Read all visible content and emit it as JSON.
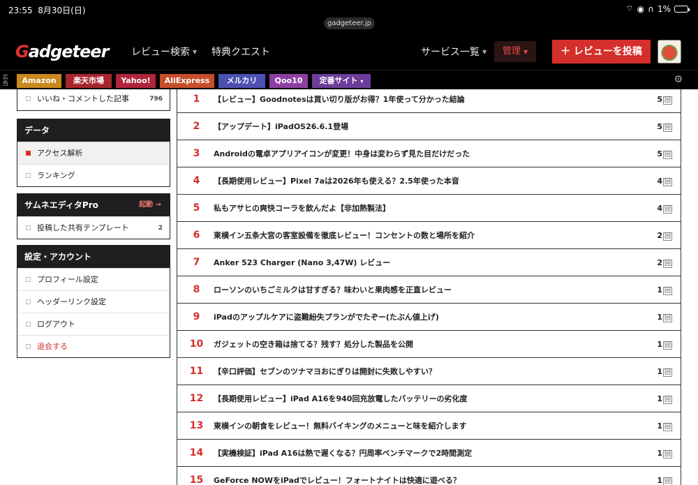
{
  "status_bar": {
    "time": "23:55",
    "date": "8月30日(日)",
    "battery": "1%"
  },
  "url": "gadgeteer.jp",
  "header": {
    "logo": "Gadgeteer",
    "nav": [
      {
        "label": "レビュー検索",
        "dropdown": true
      },
      {
        "label": "特典クエスト",
        "dropdown": false
      }
    ],
    "service": "サービス一覧",
    "admin": "管理",
    "post_button": "＋ レビューを投稿"
  },
  "ad_bar": {
    "label": "広告",
    "tags": [
      {
        "label": "Amazon",
        "color": "#c9891d"
      },
      {
        "label": "楽天市場",
        "color": "#a8262e"
      },
      {
        "label": "Yahoo!",
        "color": "#b0243c"
      },
      {
        "label": "AliExpress",
        "color": "#c64e2c"
      },
      {
        "label": "メルカリ",
        "color": "#4c50b2"
      },
      {
        "label": "Qoo10",
        "color": "#8d3fa3"
      },
      {
        "label": "定番サイト",
        "color": "#6c3d9a"
      }
    ]
  },
  "sidebar": {
    "top_item": {
      "label": "いいね・コメントした記事",
      "count": "796"
    },
    "data": {
      "title": "データ",
      "items": [
        {
          "label": "アクセス解析",
          "active": true
        },
        {
          "label": "ランキング",
          "active": false
        }
      ]
    },
    "thumb": {
      "title": "サムネエディタPro",
      "launch": "起動 →",
      "items": [
        {
          "label": "投稿した共有テンプレート",
          "count": "2"
        }
      ]
    },
    "settings": {
      "title": "設定・アカウント",
      "items": [
        {
          "label": "プロフィール設定"
        },
        {
          "label": "ヘッダーリンク設定"
        },
        {
          "label": "ログアウト"
        },
        {
          "label": "退会する"
        }
      ]
    }
  },
  "ranking": {
    "unit": "回",
    "rows": [
      {
        "rank": "1",
        "title": "【レビュー】Goodnotesは買い切り版がお得？1年使って分かった結論",
        "count": "5"
      },
      {
        "rank": "2",
        "title": "【アップデート】iPadOS26.6.1登場",
        "count": "5"
      },
      {
        "rank": "3",
        "title": "Androidの電卓アプリアイコンが変更！中身は変わらず見た目だけだった",
        "count": "5"
      },
      {
        "rank": "4",
        "title": "【長期使用レビュー】Pixel 7aは2026年も使える？2.5年使った本音",
        "count": "4"
      },
      {
        "rank": "5",
        "title": "私もアサヒの爽快コーラを飲んだよ【非加熱製法】",
        "count": "4"
      },
      {
        "rank": "6",
        "title": "東横イン五条大宮の客室設備を徹底レビュー！コンセントの数と場所を紹介",
        "count": "2"
      },
      {
        "rank": "7",
        "title": "Anker 523 Charger (Nano 3,47W) レビュー",
        "count": "2"
      },
      {
        "rank": "8",
        "title": "ローソンのいちごミルクは甘すぎる？味わいと果肉感を正直レビュー",
        "count": "1"
      },
      {
        "rank": "9",
        "title": "iPadのアップルケアに盗難紛失プランがでたぞー(たぶん値上げ)",
        "count": "1"
      },
      {
        "rank": "10",
        "title": "ガジェットの空き箱は捨てる？残す？処分した製品を公開",
        "count": "1"
      },
      {
        "rank": "11",
        "title": "【辛口評価】セブンのツナマヨおにぎりは開封に失敗しやすい？",
        "count": "1"
      },
      {
        "rank": "12",
        "title": "【長期使用レビュー】iPad A16を940回充放電したバッテリーの劣化度",
        "count": "1"
      },
      {
        "rank": "13",
        "title": "東横インの朝食をレビュー！無料バイキングのメニューと味を紹介します",
        "count": "1"
      },
      {
        "rank": "14",
        "title": "【実機検証】iPad A16は熱で遅くなる？円周率ベンチマークで2時間測定",
        "count": "1"
      },
      {
        "rank": "15",
        "title": "GeForce NOWをiPadでレビュー！フォートナイトは快適に遊べる？",
        "count": "1"
      }
    ]
  }
}
